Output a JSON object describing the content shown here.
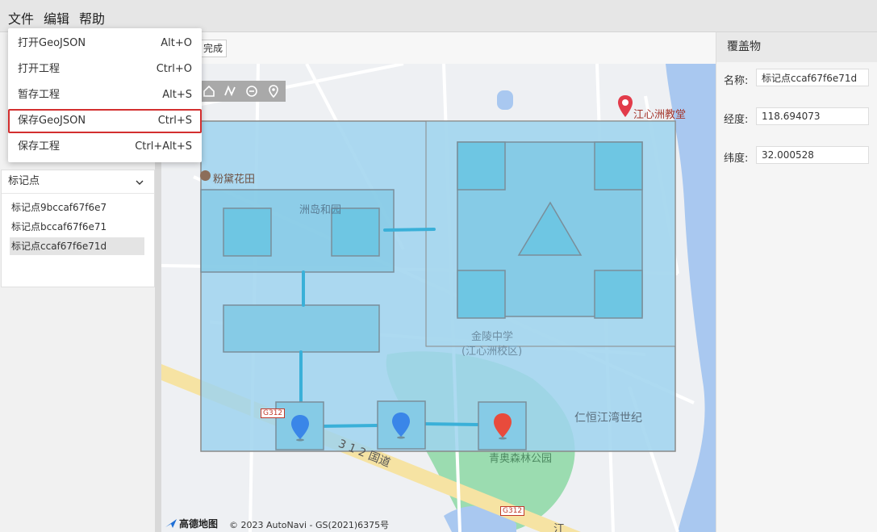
{
  "menubar": {
    "file": "文件",
    "edit": "编辑",
    "help": "帮助"
  },
  "file_menu": {
    "items": [
      {
        "label": "打开GeoJSON",
        "shortcut": "Alt+O"
      },
      {
        "label": "打开工程",
        "shortcut": "Ctrl+O"
      },
      {
        "label": "暂存工程",
        "shortcut": "Alt+S"
      },
      {
        "label": "保存GeoJSON",
        "shortcut": "Ctrl+S",
        "highlighted": true
      },
      {
        "label": "保存工程",
        "shortcut": "Ctrl+Alt+S"
      }
    ]
  },
  "toolbar": {
    "done_label": "完成",
    "tools": [
      "home-icon",
      "polyline-icon",
      "circle-icon",
      "marker-icon"
    ]
  },
  "layers": {
    "group_title": "标记点",
    "items": [
      {
        "label": "标记点9bccaf67f6e7",
        "selected": false
      },
      {
        "label": "标记点bccaf67f6e71",
        "selected": false
      },
      {
        "label": "标记点ccaf67f6e71d",
        "selected": true
      }
    ]
  },
  "map": {
    "labels": {
      "church": "江心洲教堂",
      "fendai": "粉黛花田",
      "zhoudao": "洲岛和园",
      "school": "金陵中学",
      "school_sub": "(江心洲校区)",
      "renheng": "仁恒江湾世纪",
      "qingao": "青奥森林公园",
      "road": "3 1 2 国道",
      "g312": "G312",
      "river": "江"
    },
    "attribution_logo": "高德地图",
    "attribution": "© 2023 AutoNavi - GS(2021)6375号",
    "colors": {
      "overlay_fill": "#9fd4ee",
      "box_fill": "#6ec6e3",
      "marker_blue": "#3a86e8",
      "marker_red": "#e84b3c"
    }
  },
  "properties": {
    "title": "覆盖物",
    "name_label": "名称:",
    "name_value": "标记点ccaf67f6e71d",
    "lng_label": "经度:",
    "lng_value": "118.694073",
    "lat_label": "纬度:",
    "lat_value": "32.000528"
  }
}
